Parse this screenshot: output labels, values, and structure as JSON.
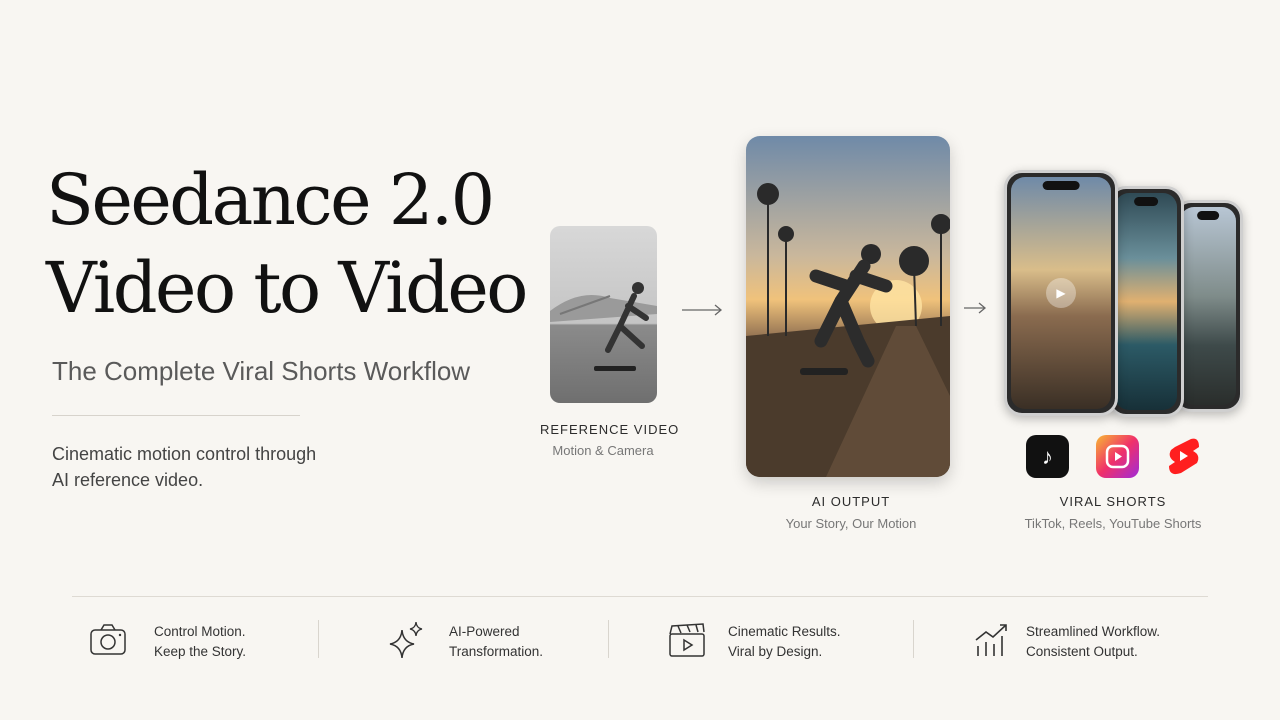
{
  "hero": {
    "title_line1": "Seedance 2.0",
    "title_line2": "Video to Video",
    "subtitle": "The Complete Viral Shorts Workflow",
    "description_line1": "Cinematic motion control through",
    "description_line2": "AI reference video."
  },
  "workflow": {
    "reference": {
      "label": "REFERENCE VIDEO",
      "sublabel": "Motion & Camera"
    },
    "output": {
      "label": "AI OUTPUT",
      "sublabel": "Your Story, Our Motion"
    },
    "shorts": {
      "label": "VIRAL SHORTS",
      "sublabel": "TikTok, Reels, YouTube Shorts"
    },
    "arrow_icon": "arrow-right",
    "platforms": [
      "tiktok-icon",
      "instagram-reels-icon",
      "youtube-shorts-icon"
    ]
  },
  "features": [
    {
      "icon": "camera-icon",
      "line1": "Control Motion.",
      "line2": "Keep the Story."
    },
    {
      "icon": "sparkle-icon",
      "line1": "AI-Powered",
      "line2": "Transformation."
    },
    {
      "icon": "clapperboard-icon",
      "line1": "Cinematic Results.",
      "line2": "Viral by Design."
    },
    {
      "icon": "growth-chart-icon",
      "line1": "Streamlined Workflow.",
      "line2": "Consistent Output."
    }
  ]
}
